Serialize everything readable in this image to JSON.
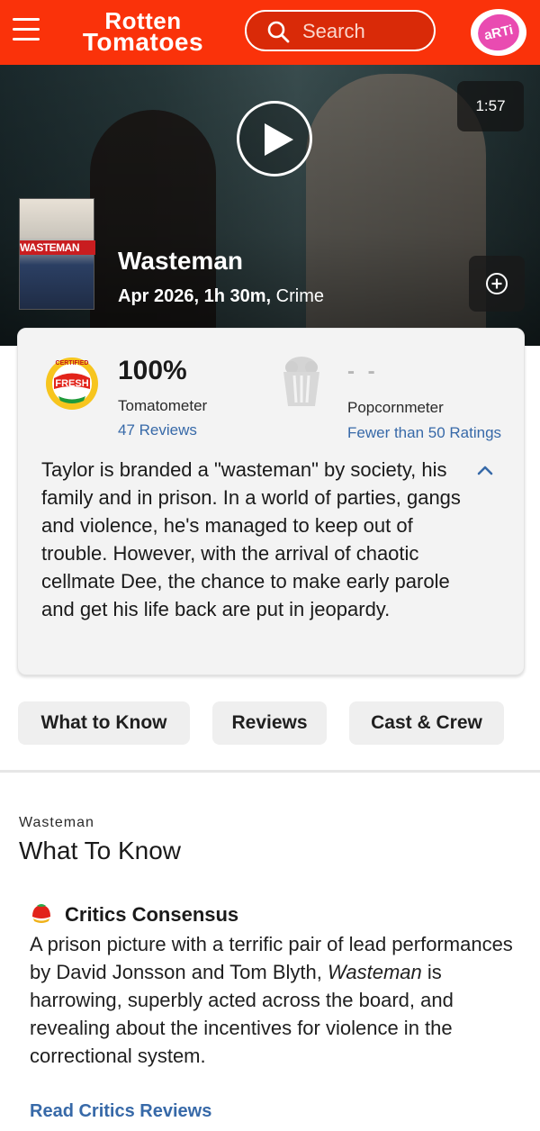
{
  "header": {
    "logo_line1": "Rotten",
    "logo_line2": "Tomatoes",
    "search_placeholder": "Search",
    "avatar_text": "aRTi"
  },
  "hero": {
    "duration": "1:57",
    "poster_title": "WASTEMAN",
    "title": "Wasteman",
    "meta_date_runtime": "Apr 2026, 1h 30m,",
    "meta_genre": "Crime"
  },
  "scores": {
    "tomatometer_score": "100%",
    "tomatometer_label": "Tomatometer",
    "tomatometer_reviews": "47 Reviews",
    "badge_top": "CERTIFIED",
    "badge_mid": "FRESH",
    "popcornmeter_score": "- -",
    "popcornmeter_label": "Popcornmeter",
    "popcornmeter_ratings": "Fewer than 50 Ratings",
    "synopsis": "Taylor is branded a \"wasteman\" by society, his family and in prison. In a world of parties, gangs and violence, he's managed to keep out of trouble. However, with the arrival of chaotic cellmate Dee, the chance to make early parole and get his life back are put in jeopardy."
  },
  "tabs": [
    {
      "label": "What to Know"
    },
    {
      "label": "Reviews"
    },
    {
      "label": "Cast & Crew"
    }
  ],
  "what_to_know": {
    "eyebrow": "Wasteman",
    "heading": "What To Know",
    "consensus_title": "Critics Consensus",
    "consensus_text_before": "A prison picture with a terrific pair of lead performances by David Jonsson and Tom Blyth, ",
    "consensus_text_italic": "Wasteman",
    "consensus_text_after": " is harrowing, superbly acted across the board, and revealing about the incentives for violence in the correctional system.",
    "read_reviews_link": "Read Critics Reviews"
  },
  "colors": {
    "brand_red": "#fa320a",
    "link_blue": "#3769a8",
    "card_bg": "#f3f3f3"
  },
  "icons": {
    "menu": "hamburger-menu-icon",
    "search": "search-icon",
    "play": "play-icon",
    "add": "add-circle-icon",
    "popcorn": "popcorn-bucket-icon",
    "collapse": "chevron-up-icon",
    "consensus": "tomato-splat-icon"
  }
}
